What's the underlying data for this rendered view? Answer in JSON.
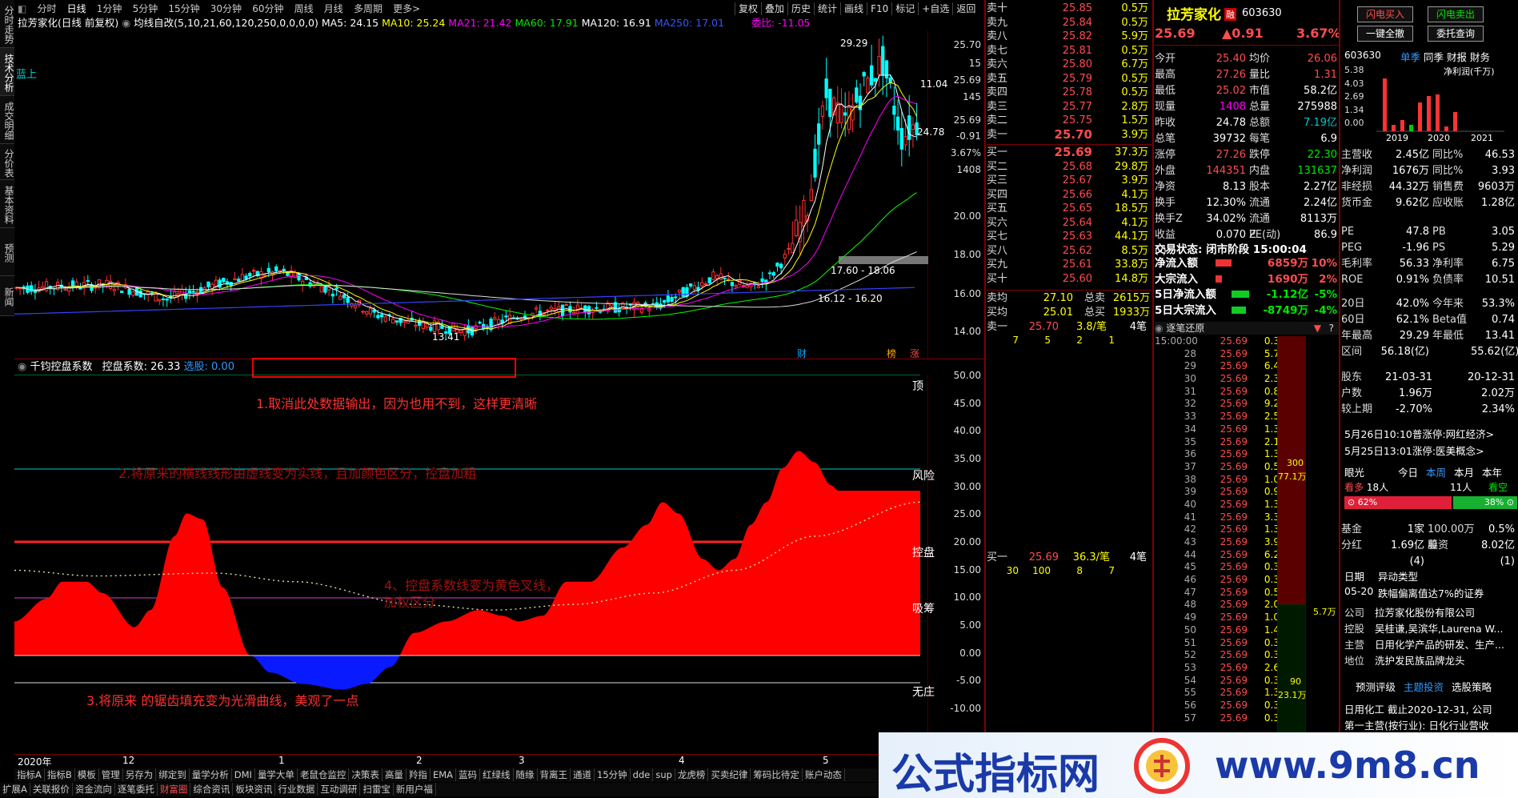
{
  "vtabs": [
    "分时走势",
    "技术分析",
    "成交明细",
    "分价表",
    "基本资料",
    "预测",
    "新闻"
  ],
  "periods": [
    "分时",
    "日线",
    "1分钟",
    "5分钟",
    "15分钟",
    "30分钟",
    "60分钟",
    "周线",
    "月线",
    "多周期",
    "更多>"
  ],
  "right_buttons": [
    "复权",
    "叠加",
    "历史",
    "统计",
    "画线",
    "F10",
    "标记",
    "+自选",
    "返回"
  ],
  "stock_title": "拉芳家化(日线 前复权)",
  "ma_header": {
    "label": "均线自改",
    "params": "(5,10,21,60,120,250,0,0,0,0)",
    "ma5": "MA5: 24.15",
    "ma10": "MA10: 25.24",
    "ma21": "MA21: 21.42",
    "ma60": "MA60: 17.91",
    "ma120": "MA120: 16.91",
    "ma250": "MA250: 17.01",
    "weibi": "委比: -11.05"
  },
  "main_chart": {
    "label_blue": "蓝上",
    "high_label": "29.29",
    "low_label": "13.41",
    "box1": "17.60 - 18.06",
    "box2": "16.12 - 16.20",
    "price_labels": [
      "11.04",
      "24.78"
    ],
    "marks": [
      "财",
      "榜",
      "涨"
    ]
  },
  "main_axis": [
    "25.70",
    "15",
    "25.69",
    "145",
    "25.69",
    "-0.91",
    "3.67%",
    "1408",
    "20.00",
    "18.00",
    "16.00",
    "14.00"
  ],
  "sub_header": {
    "name": "千钧控盘系数",
    "kp": "控盘系数: 26.33",
    "xg": "选股: 0.00"
  },
  "sub_axis": [
    "50.00",
    "45.00",
    "40.00",
    "35.00",
    "30.00",
    "25.00",
    "20.00",
    "15.00",
    "10.00",
    "5.00",
    "0.00",
    "-5.00",
    "-10.00"
  ],
  "zone_labels": [
    "顶",
    "风险",
    "控盘",
    "吸筹",
    "无庄"
  ],
  "annotations": [
    "1.取消此处数据输出，因为也用不到，这样更清晰",
    "2.将原来的横线线形由虚线变为实线，且加颜色区分，控盘加粗",
    "4、控盘系数线变为黄色叉线，",
    "加权区分",
    "3.将原来 的锯齿填充变为光滑曲线，美观了一点"
  ],
  "x_axis": [
    "2020年",
    "12",
    "1",
    "2",
    "3",
    "4",
    "5"
  ],
  "bottom_bar1": [
    "指标A",
    "指标B",
    "模板",
    "管理",
    "另存为",
    "绑定到",
    "量学分析",
    "DMI",
    "量学大单",
    "老鼠仓监控",
    "决策表",
    "高量",
    "羚指",
    "EMA",
    "蓝码",
    "红绿线",
    "随缘",
    "背离王",
    "通道",
    "15分钟",
    "dde",
    "sup",
    "龙虎榜",
    "买卖纪律",
    "筹码比待定",
    "账户动态"
  ],
  "bottom_bar2": [
    "扩展A",
    "关联报价",
    "资金流向",
    "逐笔委托",
    "财富圈",
    "综合资讯",
    "板块资讯",
    "行业数据",
    "互动调研",
    "扫雷宝",
    "新用户福"
  ],
  "orderbook": {
    "sells": [
      [
        "卖十",
        "25.85",
        "0.5万"
      ],
      [
        "卖九",
        "25.84",
        "0.5万"
      ],
      [
        "卖八",
        "25.82",
        "5.9万"
      ],
      [
        "卖七",
        "25.81",
        "0.5万"
      ],
      [
        "卖六",
        "25.80",
        "6.7万"
      ],
      [
        "卖五",
        "25.79",
        "0.5万"
      ],
      [
        "卖四",
        "25.78",
        "0.5万"
      ],
      [
        "卖三",
        "25.77",
        "2.8万"
      ],
      [
        "卖二",
        "25.75",
        "1.5万"
      ],
      [
        "卖一",
        "25.70",
        "3.9万"
      ]
    ],
    "buys": [
      [
        "买一",
        "25.69",
        "37.3万"
      ],
      [
        "买二",
        "25.68",
        "29.8万"
      ],
      [
        "买三",
        "25.67",
        "3.9万"
      ],
      [
        "买四",
        "25.66",
        "4.1万"
      ],
      [
        "买五",
        "25.65",
        "18.5万"
      ],
      [
        "买六",
        "25.64",
        "4.1万"
      ],
      [
        "买七",
        "25.63",
        "44.1万"
      ],
      [
        "买八",
        "25.62",
        "8.5万"
      ],
      [
        "买九",
        "25.61",
        "33.8万"
      ],
      [
        "买十",
        "25.60",
        "14.8万"
      ]
    ],
    "avg": [
      [
        "卖均",
        "27.10",
        "总卖",
        "2615万"
      ],
      [
        "买均",
        "25.01",
        "总买",
        "1933万"
      ]
    ],
    "sell1_detail": {
      "label": "卖一",
      "price": "25.70",
      "amt": "3.8/笔",
      "cnt": "4笔",
      "queue": [
        "7",
        "5",
        "2",
        "1"
      ]
    },
    "buy1_detail": {
      "label": "买一",
      "price": "25.69",
      "amt": "36.3/笔",
      "cnt": "4笔",
      "queue": [
        "30",
        "100",
        "8",
        "7"
      ]
    }
  },
  "quote": {
    "name": "拉芳家化",
    "tag": "融",
    "code": "603630",
    "price": "25.69",
    "chg": "▲0.91",
    "pct": "3.67%",
    "rows": [
      [
        "今开",
        "25.40",
        "均价",
        "26.06"
      ],
      [
        "最高",
        "27.26",
        "量比",
        "1.31"
      ],
      [
        "最低",
        "25.02",
        "市值",
        "58.2亿"
      ],
      [
        "现量",
        "1408",
        "总量",
        "275988"
      ],
      [
        "昨收",
        "24.78",
        "总额",
        "7.19亿"
      ],
      [
        "总笔",
        "39732",
        "每笔",
        "6.9"
      ],
      [
        "涨停",
        "27.26",
        "跌停",
        "22.30"
      ],
      [
        "外盘",
        "144351",
        "内盘",
        "131637"
      ],
      [
        "净资",
        "8.13",
        "股本",
        "2.27亿"
      ],
      [
        "换手",
        "12.30%",
        "流通",
        "2.24亿"
      ],
      [
        "换手Z",
        "34.02%",
        "流通Z",
        "8113万"
      ],
      [
        "收益(-)",
        "0.070",
        "PE(动)",
        "86.9"
      ]
    ],
    "status": "交易状态: 闭市阶段 15:00:04",
    "flows": [
      [
        "净流入额",
        "6859万",
        "10%"
      ],
      [
        "大宗流入",
        "1690万",
        "2%"
      ],
      [
        "5日净流入额",
        "-1.12亿",
        "-5%"
      ],
      [
        "5日大宗流入",
        "-8749万",
        "-4%"
      ]
    ]
  },
  "ticks": {
    "title": "逐笔还原",
    "rows": [
      [
        "15:00:00",
        "25.69",
        "0.3万"
      ],
      [
        "28",
        "25.69",
        "5.7万"
      ],
      [
        "29",
        "25.69",
        "6.4万"
      ],
      [
        "30",
        "25.69",
        "2.3万"
      ],
      [
        "31",
        "25.69",
        "0.8万"
      ],
      [
        "32",
        "25.69",
        "9.2万"
      ],
      [
        "33",
        "25.69",
        "2.5万"
      ],
      [
        "34",
        "25.69",
        "1.3万"
      ],
      [
        "35",
        "25.69",
        "2.1万"
      ],
      [
        "36",
        "25.69",
        "1.3万"
      ],
      [
        "37",
        "25.69",
        "0.5万"
      ],
      [
        "38",
        "25.69",
        "1.0万"
      ],
      [
        "39",
        "25.69",
        "0.9万"
      ],
      [
        "40",
        "25.69",
        "1.3万"
      ],
      [
        "41",
        "25.69",
        "3.3万"
      ],
      [
        "42",
        "25.69",
        "1.3万"
      ],
      [
        "43",
        "25.69",
        "3.9万"
      ],
      [
        "44",
        "25.69",
        "6.2万"
      ],
      [
        "45",
        "25.69",
        "0.3万"
      ],
      [
        "46",
        "25.69",
        "0.3万"
      ],
      [
        "47",
        "25.69",
        "0.5万"
      ],
      [
        "48",
        "25.69",
        "2.0万"
      ],
      [
        "49",
        "25.69",
        "1.0万"
      ],
      [
        "50",
        "25.69",
        "1.4万"
      ],
      [
        "51",
        "25.69",
        "0.3万"
      ],
      [
        "52",
        "25.69",
        "0.3万"
      ],
      [
        "53",
        "25.69",
        "2.6万"
      ],
      [
        "54",
        "25.69",
        "0.3万"
      ],
      [
        "55",
        "25.69",
        "1.3万"
      ],
      [
        "56",
        "25.69",
        "0.3万"
      ],
      [
        "57",
        "25.69",
        "0.3万"
      ]
    ],
    "bar_top_label": "300",
    "bar_top_value": "77.1万",
    "bar_bottom_label": "90",
    "bar_bottom_value": "23.1万",
    "side_value": "5.7万"
  },
  "f10": {
    "buttons": [
      "闪电买入",
      "闪电卖出",
      "一键全撤",
      "委托查询"
    ],
    "code": "603630",
    "tabs": [
      "单季",
      "同季",
      "财报",
      "財务"
    ],
    "chart_title": "净利润(千万)",
    "chart_axis": [
      "5.38",
      "4.03",
      "2.69",
      "1.34",
      "0.00"
    ],
    "years": [
      "2019",
      "2020",
      "2021"
    ],
    "rows1": [
      [
        "主营收",
        "2.45亿",
        "同比%",
        "46.53"
      ],
      [
        "净利润",
        "1676万",
        "同比%",
        "3.93"
      ],
      [
        "非经损",
        "44.32万",
        "销售费",
        "9603万"
      ],
      [
        "货币金",
        "9.62亿",
        "应收账",
        "1.28亿"
      ]
    ],
    "rows2": [
      [
        "PE",
        "47.8",
        "PB",
        "3.05"
      ],
      [
        "PEG",
        "-1.96",
        "PS",
        "5.29"
      ],
      [
        "毛利率",
        "56.33",
        "净利率",
        "6.75"
      ],
      [
        "ROE",
        "0.91%",
        "负债率",
        "10.51"
      ]
    ],
    "rows3": [
      [
        "20日",
        "42.0%",
        "今年来",
        "53.3%"
      ],
      [
        "60日",
        "62.1%",
        "Beta值",
        "0.74"
      ],
      [
        "年最高",
        "29.29",
        "年最低",
        "13.41"
      ],
      [
        "区间",
        "56.18(亿)",
        "",
        "55.62(亿)"
      ]
    ],
    "rows4": [
      [
        "股东",
        "21-03-31",
        "",
        "20-12-31"
      ],
      [
        "户数",
        "1.96万",
        "",
        "2.02万"
      ],
      [
        "较上期",
        "-2.70%",
        "",
        "2.34%"
      ]
    ],
    "news": [
      "5月26日10:10普涨停:网红经济>",
      "5月25日13:01涨停:医美概念>"
    ],
    "view": {
      "k": "眼光",
      "today": "今日",
      "week": "本周",
      "month": "本月",
      "year": "本年",
      "bull": "看多",
      "bull_n": "18人",
      "bear_n": "11人",
      "bear": "看空",
      "bull_pct": "62%",
      "bear_pct": "38%"
    },
    "rows5": [
      [
        "基金",
        "1家",
        "100.00万股",
        "0.5%"
      ],
      [
        "分红",
        "1.69亿(4)",
        "募资",
        "8.02亿(1)"
      ]
    ],
    "event_head": [
      "日期",
      "异动类型"
    ],
    "event": [
      "05-20",
      "跌幅偏离值达7%的证券"
    ],
    "company": [
      [
        "公司",
        "拉芳家化股份有限公司"
      ],
      [
        "控股",
        "吴桂谦,吴滨华,Laurena W..."
      ],
      [
        "主营",
        "日用化学产品的研发、生产..."
      ],
      [
        "地位",
        "洗护发民族品牌龙头"
      ]
    ],
    "rating": [
      "预测评级",
      "主题投资",
      "选股策略"
    ],
    "footer": [
      "日用化工  截止2020-12-31, 公司",
      "第一主营(按行业): 日化行业营收"
    ]
  },
  "watermark": {
    "text": "公式指标网",
    "url": "www.9m8.cn"
  }
}
